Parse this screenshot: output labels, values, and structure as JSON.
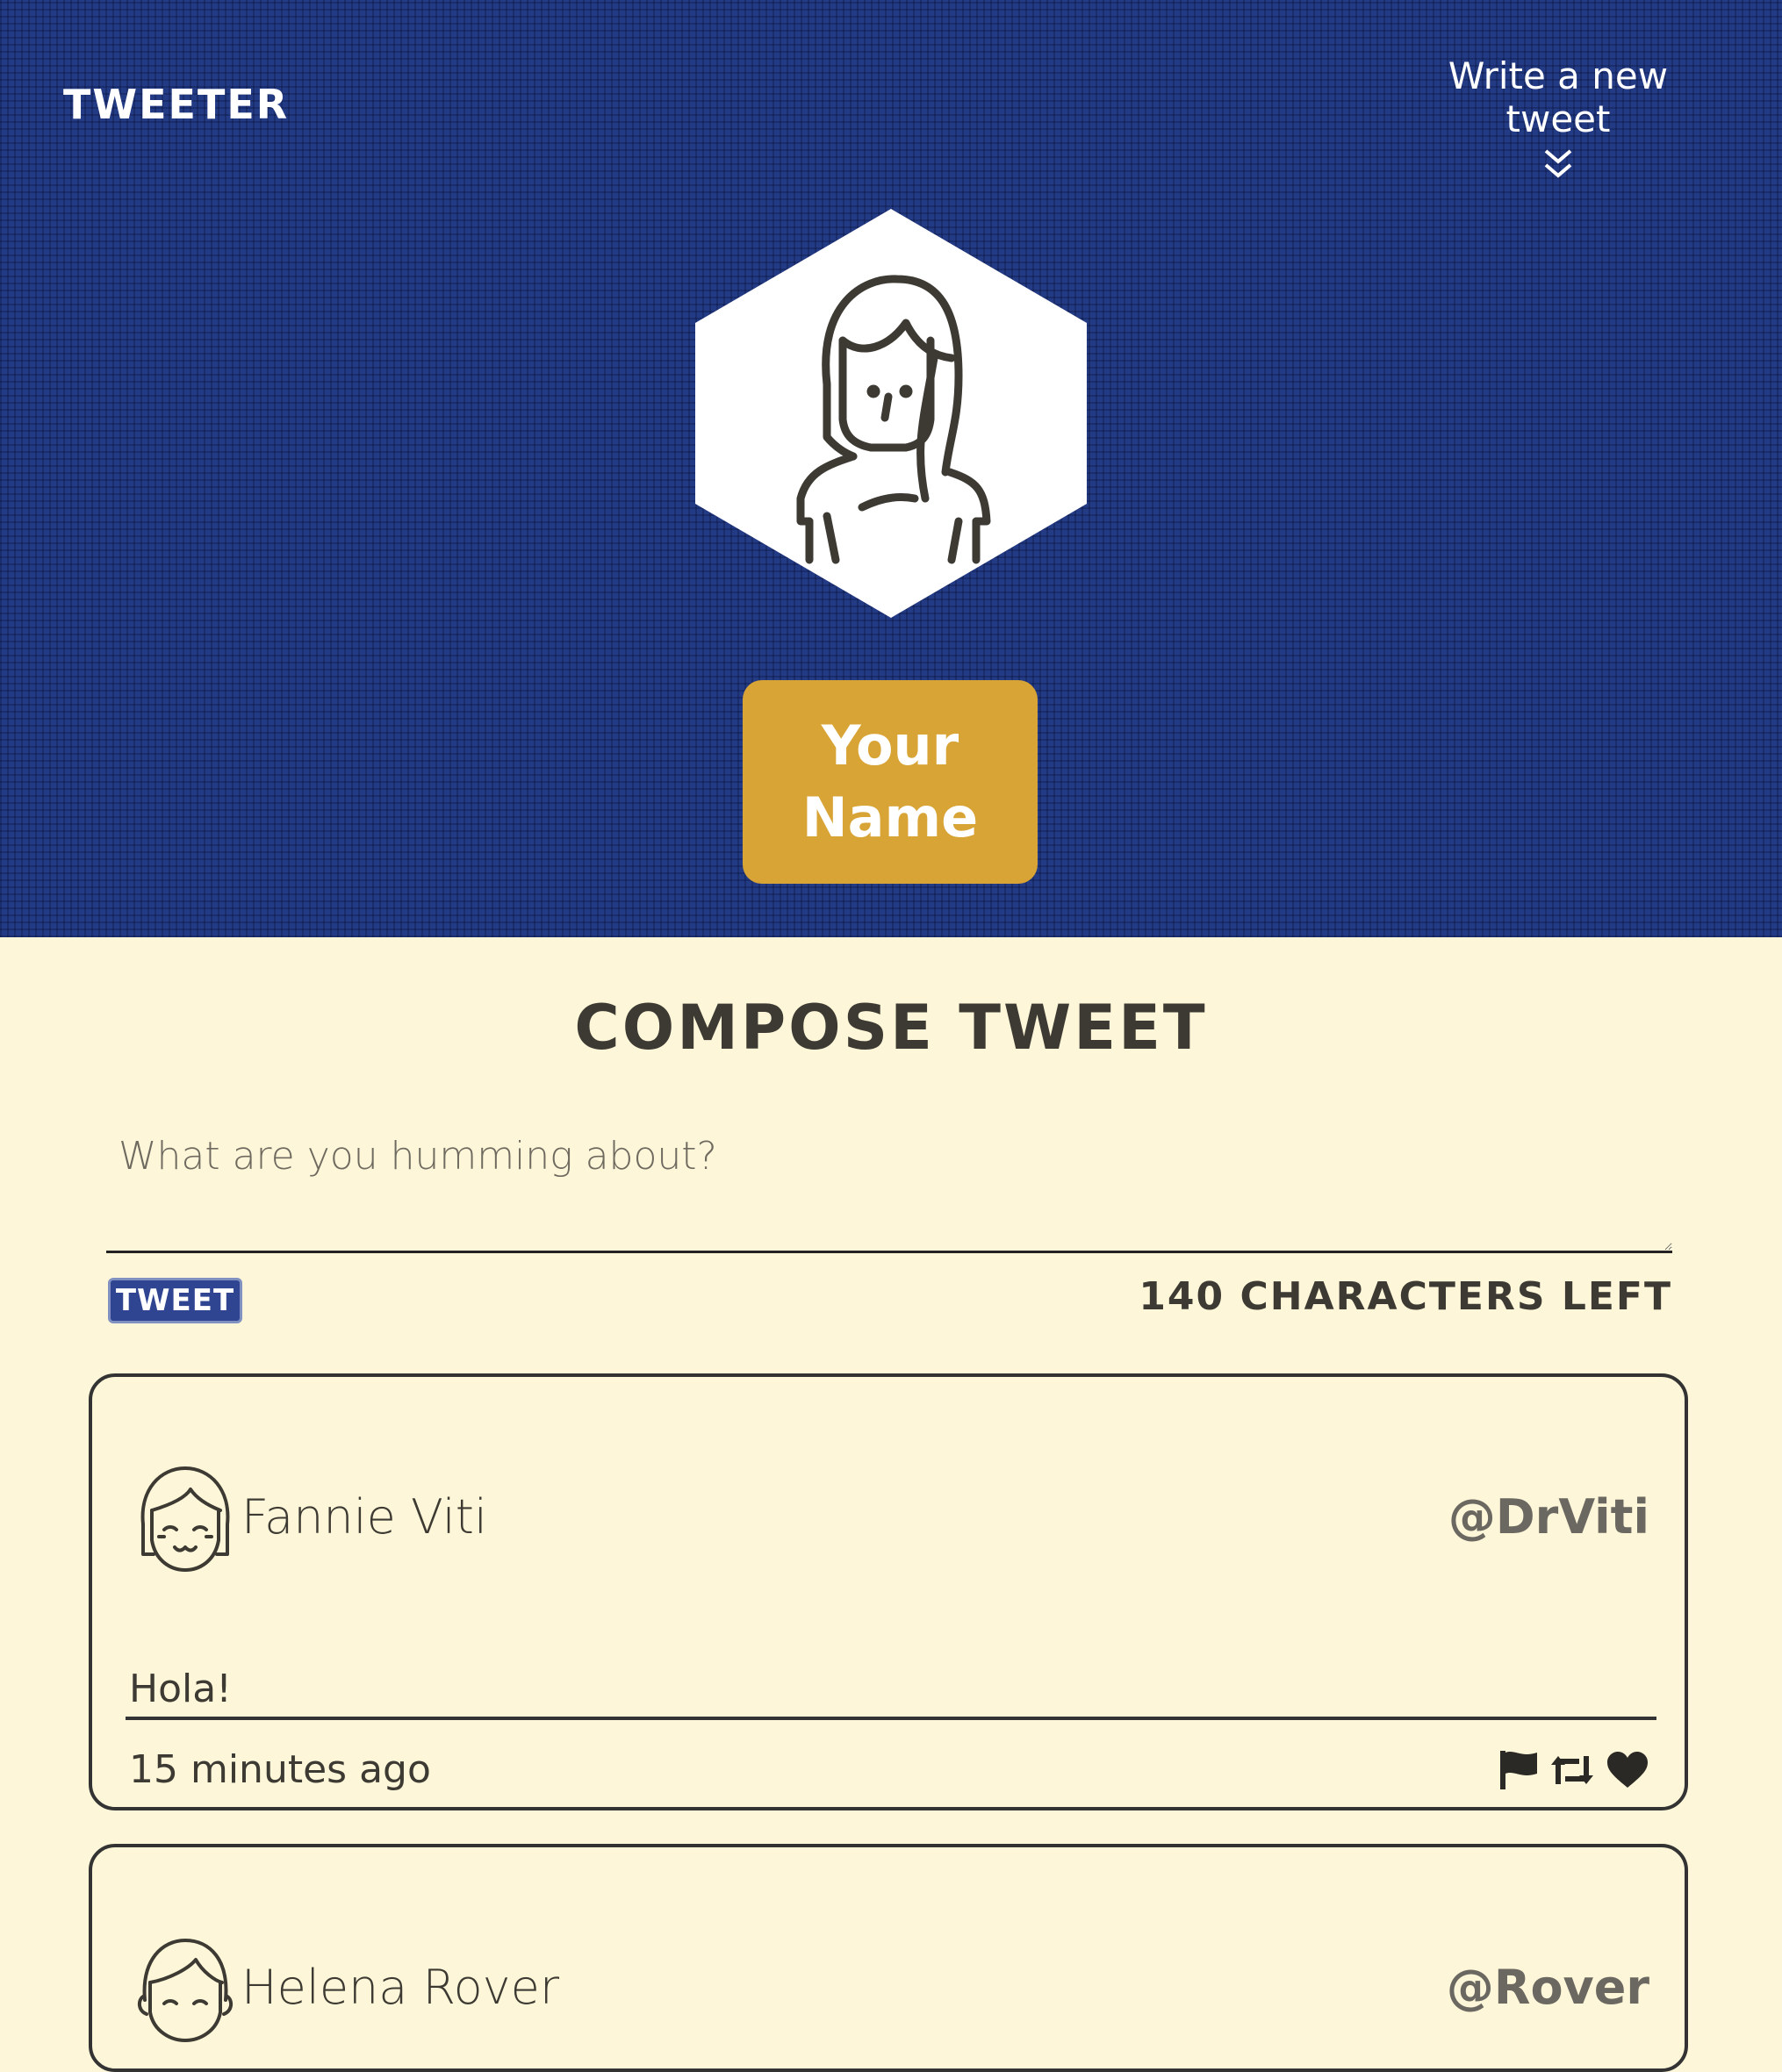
{
  "header": {
    "brand": "TWEETER",
    "write_link": "Write a new tweet",
    "write_icon": "double-chevron-down-icon"
  },
  "profile": {
    "avatar_icon": "woman-avatar-icon",
    "name": "Your Name"
  },
  "compose": {
    "title": "COMPOSE TWEET",
    "placeholder": "What are you humming about?",
    "value": "",
    "submit_label": "TWEET",
    "counter": "140 CHARACTERS LEFT"
  },
  "tweets": [
    {
      "name": "Fannie Viti",
      "handle": "@DrViti",
      "body": "Hola!",
      "time": "15 minutes ago",
      "avatar_icon": "girl-avatar-icon",
      "actions": [
        "flag-icon",
        "retweet-icon",
        "heart-icon"
      ]
    },
    {
      "name": "Helena Rover",
      "handle": "@Rover",
      "avatar_icon": "boy-avatar-icon"
    }
  ],
  "colors": {
    "header_bg": "#233a85",
    "page_bg": "#fdf6d8",
    "name_badge": "#d9a436",
    "button_bg": "#2f4592",
    "text": "#3d3a33"
  }
}
